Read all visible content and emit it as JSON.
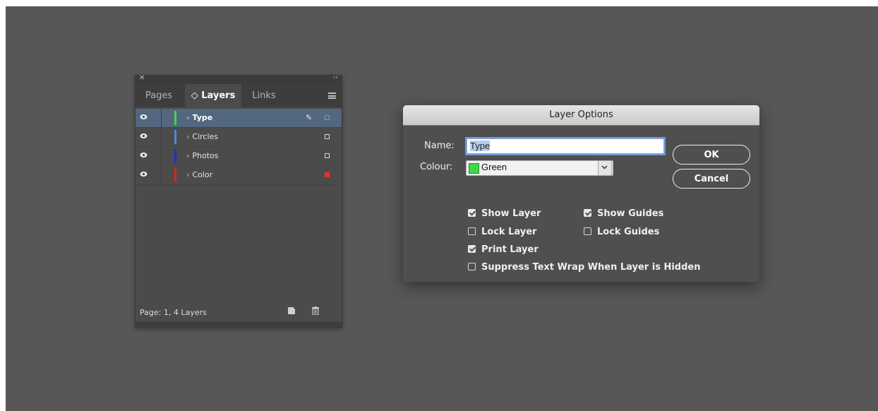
{
  "layers_panel": {
    "tabs": [
      {
        "label": "Pages",
        "active": false
      },
      {
        "label": "◇ Layers",
        "active": true
      },
      {
        "label": "Links",
        "active": false
      }
    ],
    "layers": [
      {
        "name": "Type",
        "color": "#3fd64a",
        "selected": true,
        "visible": true,
        "icon": "pencil-icon",
        "square_color": "#5aa0ff"
      },
      {
        "name": "Circles",
        "color": "#4a8be0",
        "selected": false,
        "visible": true,
        "square_color": "#d8d8d8"
      },
      {
        "name": "Photos",
        "color": "#1a2fd6",
        "selected": false,
        "visible": true,
        "square_color": "#d8d8d8"
      },
      {
        "name": "Color",
        "color": "#e02020",
        "selected": false,
        "visible": true,
        "square_color": "#ff2a2a"
      }
    ],
    "footer_text": "Page: 1, 4 Layers",
    "footer_icons": [
      "new-layer-icon",
      "trash-icon"
    ]
  },
  "dialog": {
    "title": "Layer Options",
    "name_label": "Name:",
    "name_value": "Type",
    "colour_label": "Colour:",
    "colour_value": "Green",
    "colour_swatch": "#3fd64a",
    "ok_label": "OK",
    "cancel_label": "Cancel",
    "options": [
      {
        "label": "Show Layer",
        "checked": true
      },
      {
        "label": "Show Guides",
        "checked": true
      },
      {
        "label": "Lock Layer",
        "checked": false
      },
      {
        "label": "Lock Guides",
        "checked": false
      },
      {
        "label": "Print Layer",
        "checked": true
      },
      {
        "label": "Suppress Text Wrap When Layer is Hidden",
        "checked": false
      }
    ]
  }
}
